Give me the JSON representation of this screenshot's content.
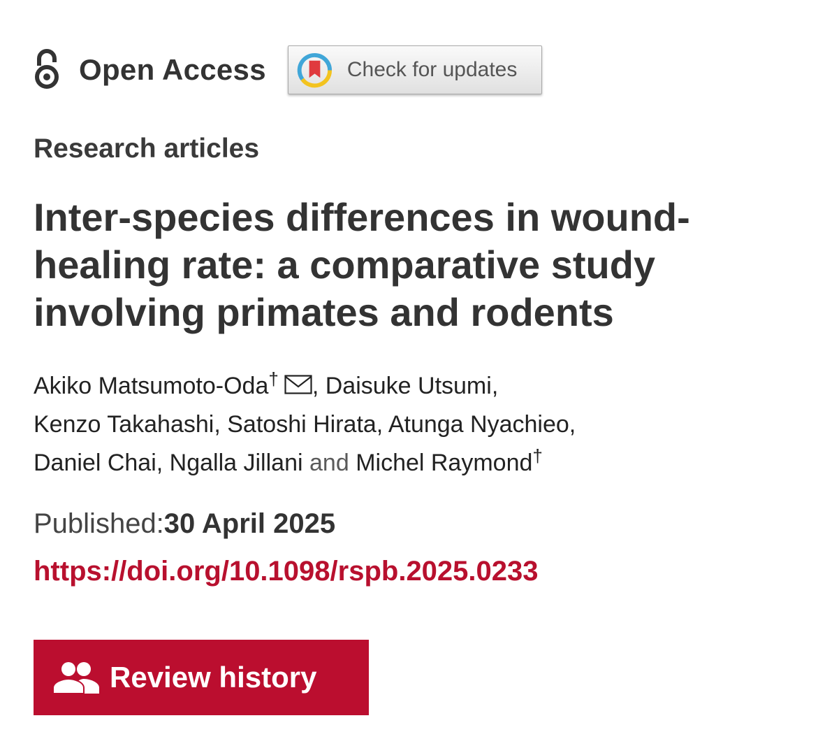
{
  "open_access": {
    "label": "Open Access",
    "icon": "open-access-lock-icon"
  },
  "updates_button": {
    "label": "Check for updates",
    "icon": "crossmark-icon"
  },
  "article": {
    "category": "Research articles",
    "title": "Inter-species differences in wound-healing rate: a comparative study involving primates and rodents",
    "authors": [
      {
        "name": "Akiko Matsumoto-Oda",
        "mark": "†"
      },
      {
        "name": "Daisuke Utsumi"
      },
      {
        "name": "Kenzo Takahashi"
      },
      {
        "name": "Satoshi Hirata"
      },
      {
        "name": "Atunga Nyachieo"
      },
      {
        "name": "Daniel Chai"
      },
      {
        "name": "Ngalla Jillani"
      },
      {
        "name": "Michel Raymond",
        "mark": "†"
      }
    ],
    "authors_separator": ",",
    "authors_and": "and",
    "published_label": "Published:",
    "published_date": "30 April 2025",
    "doi": "https://doi.org/10.1098/rspb.2025.0233"
  },
  "review_button": {
    "label": "Review history",
    "icon": "people-icon"
  },
  "colors": {
    "accent": "#bb0e2f",
    "link": "#b8102e",
    "text": "#333333"
  }
}
